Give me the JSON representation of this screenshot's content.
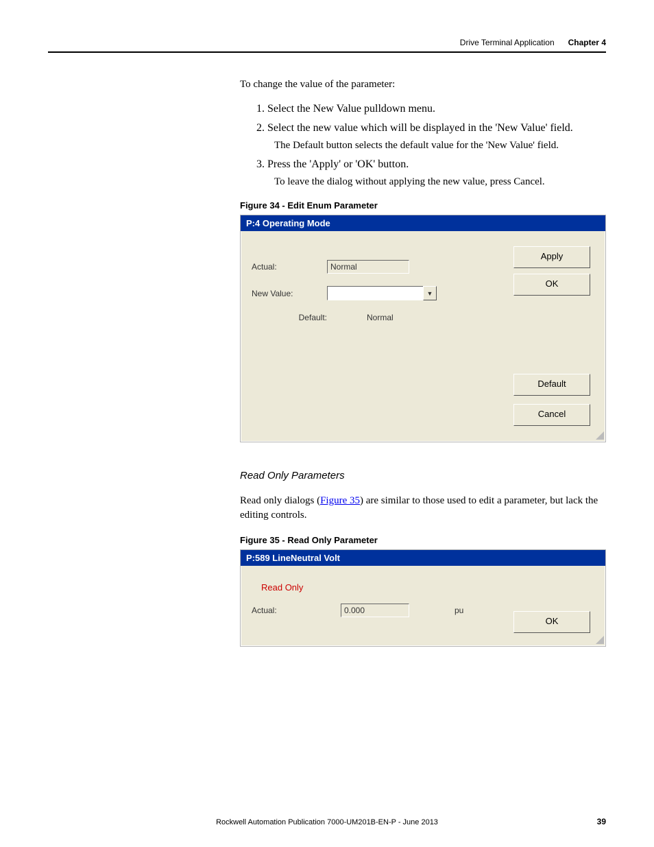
{
  "header": {
    "section": "Drive Terminal Application",
    "chapter": "Chapter 4"
  },
  "intro": "To change the value of the parameter:",
  "steps": {
    "s1": "Select the New Value pulldown menu.",
    "s2": "Select the new value which will be displayed in the 'New Value' field.",
    "s2b": "The Default button selects the default value for the 'New Value' field.",
    "s3": "Press the 'Apply' or 'OK' button.",
    "s3b": "To leave the dialog without applying the new value, press Cancel."
  },
  "fig34": {
    "caption": "Figure 34 - Edit Enum Parameter",
    "title": "P:4 Operating Mode",
    "actual_label": "Actual:",
    "actual_value": "Normal",
    "newvalue_label": "New Value:",
    "default_label": "Default:",
    "default_value": "Normal",
    "btn_apply": "Apply",
    "btn_ok": "OK",
    "btn_default": "Default",
    "btn_cancel": "Cancel"
  },
  "readonly_section": {
    "heading": "Read Only Parameters",
    "para_a": "Read only dialogs (",
    "link": "Figure 35",
    "para_b": ") are similar to those used to edit a parameter, but lack the editing controls."
  },
  "fig35": {
    "caption": "Figure 35 - Read Only Parameter",
    "title": "P:589 LineNeutral Volt",
    "readonly": "Read Only",
    "actual_label": "Actual:",
    "actual_value": "0.000",
    "unit": "pu",
    "btn_ok": "OK"
  },
  "footer": {
    "pub": "Rockwell Automation Publication 7000-UM201B-EN-P - June 2013",
    "page": "39"
  }
}
